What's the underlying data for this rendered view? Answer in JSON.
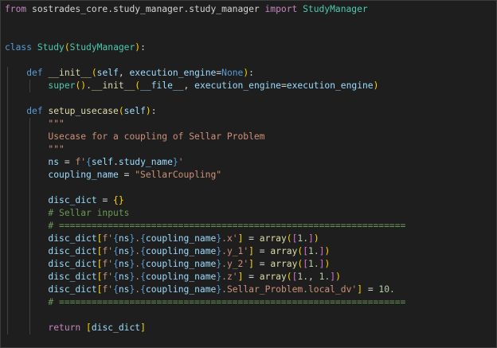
{
  "editor": {
    "lines": [
      [
        {
          "t": "from",
          "c": "kwc"
        },
        {
          "t": " sostrades_core.study_manager.study_manager ",
          "c": "plain"
        },
        {
          "t": "import",
          "c": "kwc"
        },
        {
          "t": " StudyManager",
          "c": "cls"
        }
      ],
      [],
      [],
      [
        {
          "t": "class",
          "c": "kw"
        },
        {
          "t": " ",
          "c": "plain"
        },
        {
          "t": "Study",
          "c": "cls"
        },
        {
          "t": "(",
          "c": "br1"
        },
        {
          "t": "StudyManager",
          "c": "cls"
        },
        {
          "t": ")",
          "c": "br1"
        },
        {
          "t": ":",
          "c": "plain"
        }
      ],
      [],
      [
        {
          "t": "    ",
          "c": "plain"
        },
        {
          "t": "def",
          "c": "kw"
        },
        {
          "t": " ",
          "c": "plain"
        },
        {
          "t": "__init__",
          "c": "fn"
        },
        {
          "t": "(",
          "c": "br1"
        },
        {
          "t": "self",
          "c": "var"
        },
        {
          "t": ", ",
          "c": "plain"
        },
        {
          "t": "execution_engine",
          "c": "var"
        },
        {
          "t": "=",
          "c": "op"
        },
        {
          "t": "None",
          "c": "kw"
        },
        {
          "t": ")",
          "c": "br1"
        },
        {
          "t": ":",
          "c": "plain"
        }
      ],
      [
        {
          "t": "        ",
          "c": "plain"
        },
        {
          "t": "super",
          "c": "cls"
        },
        {
          "t": "(",
          "c": "br1"
        },
        {
          "t": ")",
          "c": "br1"
        },
        {
          "t": ".",
          "c": "plain"
        },
        {
          "t": "__init__",
          "c": "fn"
        },
        {
          "t": "(",
          "c": "br1"
        },
        {
          "t": "__file__",
          "c": "var"
        },
        {
          "t": ", ",
          "c": "plain"
        },
        {
          "t": "execution_engine",
          "c": "var"
        },
        {
          "t": "=",
          "c": "op"
        },
        {
          "t": "execution_engine",
          "c": "var"
        },
        {
          "t": ")",
          "c": "br1"
        }
      ],
      [],
      [
        {
          "t": "    ",
          "c": "plain"
        },
        {
          "t": "def",
          "c": "kw"
        },
        {
          "t": " ",
          "c": "plain"
        },
        {
          "t": "setup_usecase",
          "c": "fn"
        },
        {
          "t": "(",
          "c": "br1"
        },
        {
          "t": "self",
          "c": "var"
        },
        {
          "t": ")",
          "c": "br1"
        },
        {
          "t": ":",
          "c": "plain"
        }
      ],
      [
        {
          "t": "        ",
          "c": "plain"
        },
        {
          "t": "\"\"\"",
          "c": "str"
        }
      ],
      [
        {
          "t": "        ",
          "c": "plain"
        },
        {
          "t": "Usecase for a coupling of Sellar Problem",
          "c": "str"
        }
      ],
      [
        {
          "t": "        ",
          "c": "plain"
        },
        {
          "t": "\"\"\"",
          "c": "str"
        }
      ],
      [
        {
          "t": "        ",
          "c": "plain"
        },
        {
          "t": "ns",
          "c": "var"
        },
        {
          "t": " = ",
          "c": "op"
        },
        {
          "t": "f'",
          "c": "str"
        },
        {
          "t": "{",
          "c": "kw"
        },
        {
          "t": "self",
          "c": "var"
        },
        {
          "t": ".",
          "c": "plain"
        },
        {
          "t": "study_name",
          "c": "var"
        },
        {
          "t": "}",
          "c": "kw"
        },
        {
          "t": "'",
          "c": "str"
        }
      ],
      [
        {
          "t": "        ",
          "c": "plain"
        },
        {
          "t": "coupling_name",
          "c": "var"
        },
        {
          "t": " = ",
          "c": "op"
        },
        {
          "t": "\"SellarCoupling\"",
          "c": "str"
        }
      ],
      [],
      [
        {
          "t": "        ",
          "c": "plain"
        },
        {
          "t": "disc_dict",
          "c": "var"
        },
        {
          "t": " = ",
          "c": "op"
        },
        {
          "t": "{",
          "c": "br1"
        },
        {
          "t": "}",
          "c": "br1"
        }
      ],
      [
        {
          "t": "        ",
          "c": "plain"
        },
        {
          "t": "# Sellar inputs",
          "c": "cmt"
        }
      ],
      [
        {
          "t": "        ",
          "c": "plain"
        },
        {
          "t": "# ================================================================",
          "c": "cmt"
        }
      ],
      [
        {
          "t": "        ",
          "c": "plain"
        },
        {
          "t": "disc_dict",
          "c": "var"
        },
        {
          "t": "[",
          "c": "br1"
        },
        {
          "t": "f'",
          "c": "str"
        },
        {
          "t": "{",
          "c": "kw"
        },
        {
          "t": "ns",
          "c": "var"
        },
        {
          "t": "}",
          "c": "kw"
        },
        {
          "t": ".",
          "c": "str"
        },
        {
          "t": "{",
          "c": "kw"
        },
        {
          "t": "coupling_name",
          "c": "var"
        },
        {
          "t": "}",
          "c": "kw"
        },
        {
          "t": ".x'",
          "c": "str"
        },
        {
          "t": "]",
          "c": "br1"
        },
        {
          "t": " = ",
          "c": "op"
        },
        {
          "t": "array",
          "c": "fn"
        },
        {
          "t": "(",
          "c": "br1"
        },
        {
          "t": "[",
          "c": "br2"
        },
        {
          "t": "1.",
          "c": "num"
        },
        {
          "t": "]",
          "c": "br2"
        },
        {
          "t": ")",
          "c": "br1"
        }
      ],
      [
        {
          "t": "        ",
          "c": "plain"
        },
        {
          "t": "disc_dict",
          "c": "var"
        },
        {
          "t": "[",
          "c": "br1"
        },
        {
          "t": "f'",
          "c": "str"
        },
        {
          "t": "{",
          "c": "kw"
        },
        {
          "t": "ns",
          "c": "var"
        },
        {
          "t": "}",
          "c": "kw"
        },
        {
          "t": ".",
          "c": "str"
        },
        {
          "t": "{",
          "c": "kw"
        },
        {
          "t": "coupling_name",
          "c": "var"
        },
        {
          "t": "}",
          "c": "kw"
        },
        {
          "t": ".y_1'",
          "c": "str"
        },
        {
          "t": "]",
          "c": "br1"
        },
        {
          "t": " = ",
          "c": "op"
        },
        {
          "t": "array",
          "c": "fn"
        },
        {
          "t": "(",
          "c": "br1"
        },
        {
          "t": "[",
          "c": "br2"
        },
        {
          "t": "1.",
          "c": "num"
        },
        {
          "t": "]",
          "c": "br2"
        },
        {
          "t": ")",
          "c": "br1"
        }
      ],
      [
        {
          "t": "        ",
          "c": "plain"
        },
        {
          "t": "disc_dict",
          "c": "var"
        },
        {
          "t": "[",
          "c": "br1"
        },
        {
          "t": "f'",
          "c": "str"
        },
        {
          "t": "{",
          "c": "kw"
        },
        {
          "t": "ns",
          "c": "var"
        },
        {
          "t": "}",
          "c": "kw"
        },
        {
          "t": ".",
          "c": "str"
        },
        {
          "t": "{",
          "c": "kw"
        },
        {
          "t": "coupling_name",
          "c": "var"
        },
        {
          "t": "}",
          "c": "kw"
        },
        {
          "t": ".y_2'",
          "c": "str"
        },
        {
          "t": "]",
          "c": "br1"
        },
        {
          "t": " = ",
          "c": "op"
        },
        {
          "t": "array",
          "c": "fn"
        },
        {
          "t": "(",
          "c": "br1"
        },
        {
          "t": "[",
          "c": "br2"
        },
        {
          "t": "1.",
          "c": "num"
        },
        {
          "t": "]",
          "c": "br2"
        },
        {
          "t": ")",
          "c": "br1"
        }
      ],
      [
        {
          "t": "        ",
          "c": "plain"
        },
        {
          "t": "disc_dict",
          "c": "var"
        },
        {
          "t": "[",
          "c": "br1"
        },
        {
          "t": "f'",
          "c": "str"
        },
        {
          "t": "{",
          "c": "kw"
        },
        {
          "t": "ns",
          "c": "var"
        },
        {
          "t": "}",
          "c": "kw"
        },
        {
          "t": ".",
          "c": "str"
        },
        {
          "t": "{",
          "c": "kw"
        },
        {
          "t": "coupling_name",
          "c": "var"
        },
        {
          "t": "}",
          "c": "kw"
        },
        {
          "t": ".z'",
          "c": "str"
        },
        {
          "t": "]",
          "c": "br1"
        },
        {
          "t": " = ",
          "c": "op"
        },
        {
          "t": "array",
          "c": "fn"
        },
        {
          "t": "(",
          "c": "br1"
        },
        {
          "t": "[",
          "c": "br2"
        },
        {
          "t": "1.",
          "c": "num"
        },
        {
          "t": ", ",
          "c": "plain"
        },
        {
          "t": "1.",
          "c": "num"
        },
        {
          "t": "]",
          "c": "br2"
        },
        {
          "t": ")",
          "c": "br1"
        }
      ],
      [
        {
          "t": "        ",
          "c": "plain"
        },
        {
          "t": "disc_dict",
          "c": "var"
        },
        {
          "t": "[",
          "c": "br1"
        },
        {
          "t": "f'",
          "c": "str"
        },
        {
          "t": "{",
          "c": "kw"
        },
        {
          "t": "ns",
          "c": "var"
        },
        {
          "t": "}",
          "c": "kw"
        },
        {
          "t": ".",
          "c": "str"
        },
        {
          "t": "{",
          "c": "kw"
        },
        {
          "t": "coupling_name",
          "c": "var"
        },
        {
          "t": "}",
          "c": "kw"
        },
        {
          "t": ".Sellar_Problem.local_dv'",
          "c": "str"
        },
        {
          "t": "]",
          "c": "br1"
        },
        {
          "t": " = ",
          "c": "op"
        },
        {
          "t": "10.",
          "c": "num"
        }
      ],
      [
        {
          "t": "        ",
          "c": "plain"
        },
        {
          "t": "# ================================================================",
          "c": "cmt"
        }
      ],
      [],
      [
        {
          "t": "        ",
          "c": "plain"
        },
        {
          "t": "return",
          "c": "kwc"
        },
        {
          "t": " ",
          "c": "plain"
        },
        {
          "t": "[",
          "c": "br1"
        },
        {
          "t": "disc_dict",
          "c": "var"
        },
        {
          "t": "]",
          "c": "br1"
        }
      ]
    ],
    "colors": {
      "background": "#1e1e1e",
      "keyword": "#569cd6",
      "control_keyword": "#c586c0",
      "class": "#4ec9b0",
      "function": "#dcdcaa",
      "variable": "#9cdcfe",
      "string": "#ce9178",
      "comment": "#6a9955",
      "number": "#b5cea8",
      "bracket": "#ffd700"
    }
  }
}
